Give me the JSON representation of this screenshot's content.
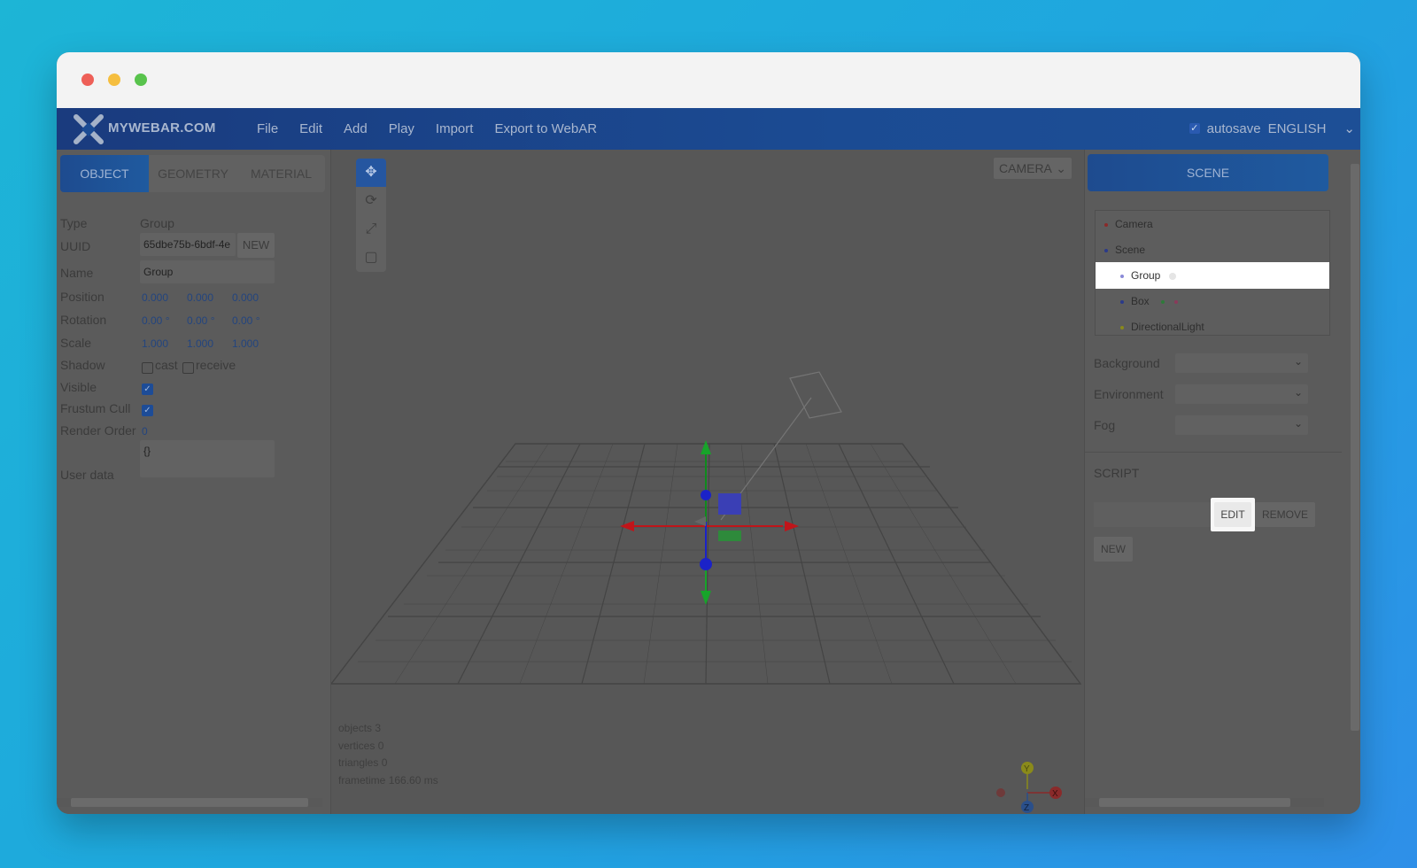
{
  "app": {
    "brand": "MYWEBAR.COM",
    "menu": [
      "File",
      "Edit",
      "Add",
      "Play",
      "Import",
      "Export to WebAR"
    ],
    "autosave_label": "autosave",
    "language": "ENGLISH"
  },
  "left_panel": {
    "tabs": [
      "OBJECT",
      "GEOMETRY",
      "MATERIAL"
    ],
    "props": {
      "type_label": "Type",
      "type_value": "Group",
      "uuid_label": "UUID",
      "uuid_value": "65dbe75b-6bdf-4e",
      "uuid_new": "NEW",
      "name_label": "Name",
      "name_value": "Group",
      "position_label": "Position",
      "position": [
        "0.000",
        "0.000",
        "0.000"
      ],
      "rotation_label": "Rotation",
      "rotation": [
        "0.00 °",
        "0.00 °",
        "0.00 °"
      ],
      "scale_label": "Scale",
      "scale": [
        "1.000",
        "1.000",
        "1.000"
      ],
      "shadow_label": "Shadow",
      "cast_label": "cast",
      "receive_label": "receive",
      "visible_label": "Visible",
      "frustum_label": "Frustum Cull",
      "render_order_label": "Render Order",
      "render_order_value": "0",
      "userdata_label": "User data",
      "userdata_value": "{}"
    }
  },
  "viewport": {
    "camera_select": "CAMERA",
    "stats": {
      "objects_label": "objects",
      "objects": "3",
      "vertices_label": "vertices",
      "vertices": "0",
      "triangles_label": "triangles",
      "triangles": "0",
      "frametime_label": "frametime",
      "frametime": "166.60 ms"
    },
    "axis_labels": [
      "Y",
      "X",
      "Z"
    ]
  },
  "right_panel": {
    "scene_button": "SCENE",
    "outliner": [
      "Camera",
      "Scene",
      "Group",
      "Box",
      "DirectionalLight"
    ],
    "background_label": "Background",
    "environment_label": "Environment",
    "fog_label": "Fog",
    "script_label": "SCRIPT",
    "edit_button": "EDIT",
    "remove_button": "REMOVE",
    "new_button": "NEW"
  },
  "colors": {
    "accent": "#1f5a9f",
    "gizmo_red": "#c0151a",
    "gizmo_green": "#17a42a",
    "gizmo_blue": "#1b22c8"
  }
}
